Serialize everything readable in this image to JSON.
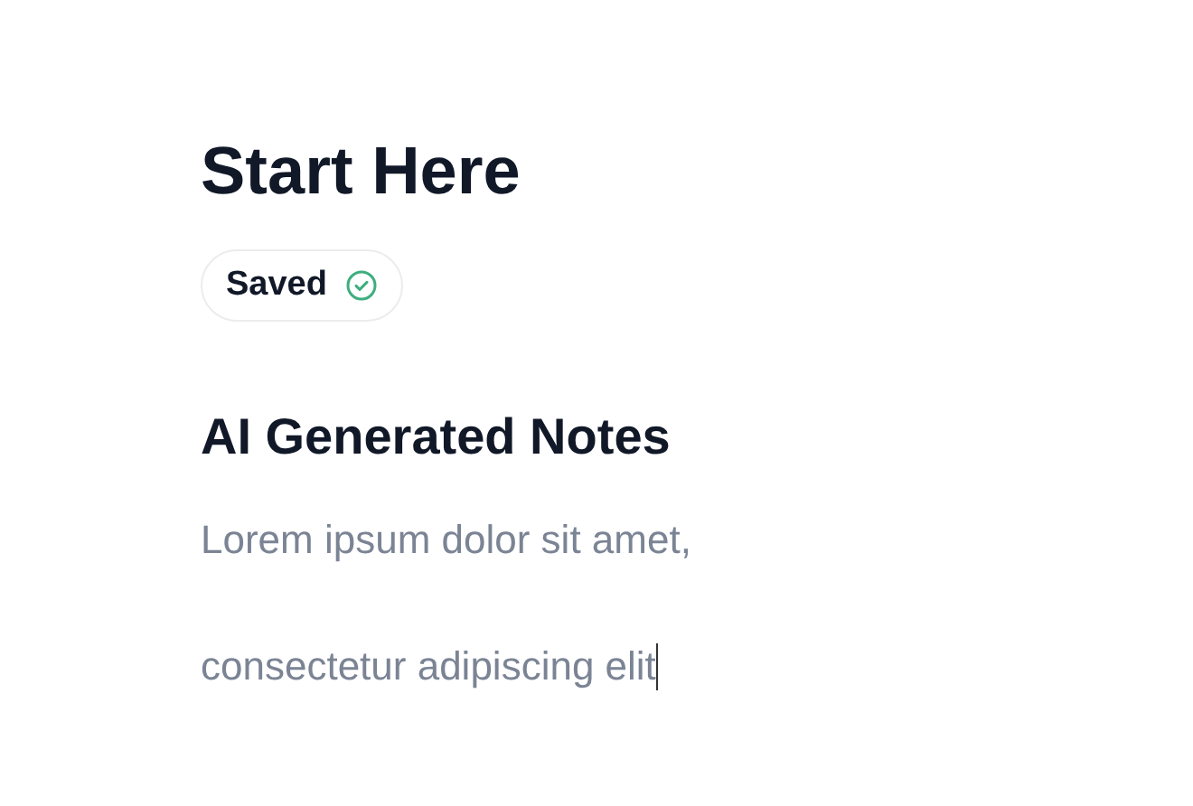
{
  "title": "Start Here",
  "status": {
    "label": "Saved",
    "saved": true
  },
  "notes": {
    "heading": "AI Generated Notes",
    "lines": [
      "Lorem ipsum dolor sit amet,",
      "consectetur adipiscing elit"
    ]
  }
}
